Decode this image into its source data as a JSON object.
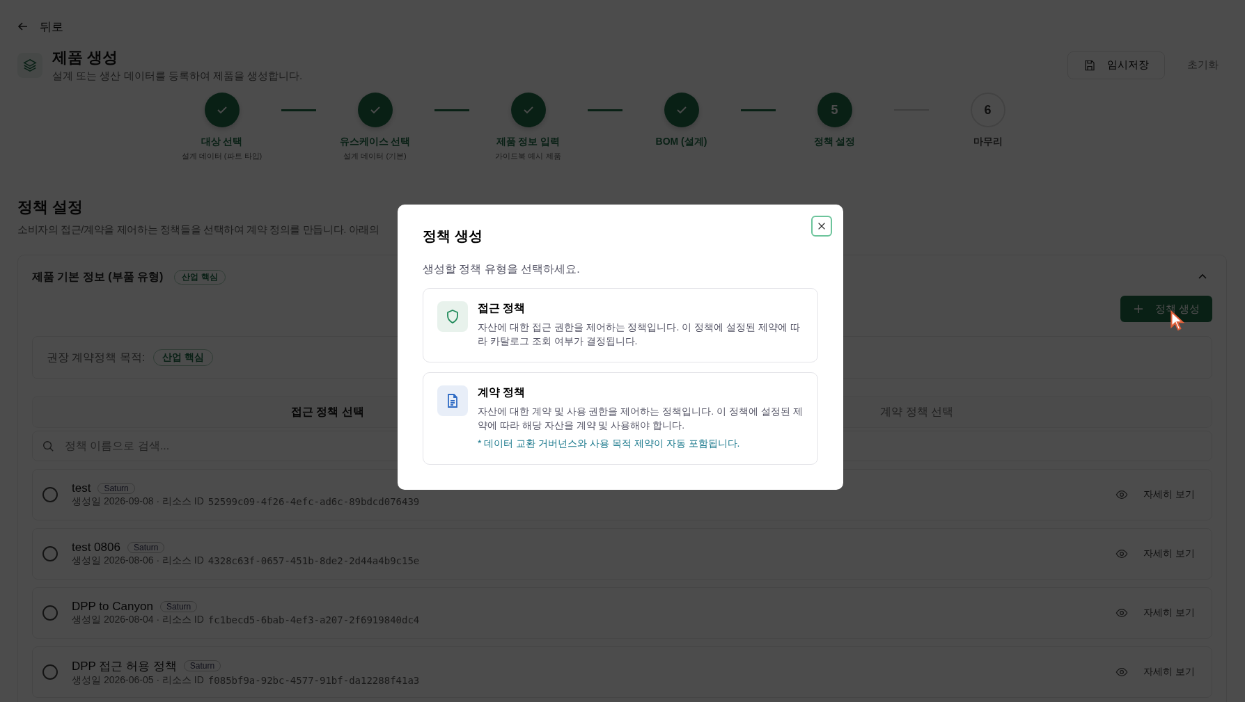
{
  "back": {
    "label": "뒤로"
  },
  "header": {
    "title": "제품 생성",
    "subtitle": "설계 또는 생산 데이터를 등록하여 제품을 생성합니다.",
    "save_button": "임시저장",
    "reset_button": "초기화"
  },
  "steps": [
    {
      "label": "대상 선택",
      "sublabel": "설계 데이터 (파트 타입)",
      "completed": true,
      "current": false
    },
    {
      "label": "유스케이스 선택",
      "sublabel": "설계 데이터 (기본)",
      "completed": true,
      "current": false
    },
    {
      "label": "제품 정보 입력",
      "sublabel": "가이드북 예시 제품",
      "completed": true,
      "current": false
    },
    {
      "label": "BOM (설계)",
      "completed": true,
      "current": false
    },
    {
      "marker": "5",
      "label": "정책 설정",
      "completed": false,
      "current": true
    },
    {
      "marker": "6",
      "label": "마무리",
      "completed": false,
      "current": false
    }
  ],
  "section": {
    "title": "정책 설정",
    "description": "소비자의 접근/계약을 제어하는 정책들을 선택하여 계약 정의를 만듭니다. 아래의"
  },
  "card": {
    "title": "제품 기본 정보 (부품 유형)",
    "badge": "산업 핵심",
    "expanded": true,
    "create_button": "정책 생성",
    "recommendation": {
      "label": "권장 계약정책 목적:",
      "badge": "산업 핵심"
    },
    "tabs": [
      {
        "label": "접근 정책 선택",
        "selected": true
      },
      {
        "label": "계약 정책 선택",
        "selected": false
      }
    ],
    "search": {
      "placeholder": "정책 이름으로 검색..."
    },
    "policies": [
      {
        "name": "test",
        "tag": "Saturn",
        "meta": "생성일 2026-09-08 · 리소스 ID",
        "id": "52599c09-4f26-4efc-ad6c-89bdcd076439",
        "selected": false,
        "action": "자세히 보기"
      },
      {
        "name": "test 0806",
        "tag": "Saturn",
        "meta": "생성일 2026-08-06 · 리소스 ID",
        "id": "4328c63f-0657-451b-8de2-2d44a4b9c15e",
        "selected": false,
        "action": "자세히 보기"
      },
      {
        "name": "DPP to Canyon",
        "tag": "Saturn",
        "meta": "생성일 2026-08-04 · 리소스 ID",
        "id": "fc1becd5-6bab-4ef3-a207-2f6919840dc4",
        "selected": false,
        "action": "자세히 보기"
      },
      {
        "name": "DPP 접근 허용 정책",
        "tag": "Saturn",
        "meta": "생성일 2026-06-05 · 리소스 ID",
        "id": "f085bf9a-92bc-4577-91bf-da12288f41a3",
        "selected": false,
        "action": "자세히 보기"
      }
    ]
  },
  "modal": {
    "title": "정책 생성",
    "prompt": "생성할 정책 유형을 선택하세요.",
    "options": [
      {
        "kind": "access",
        "title": "접근 정책",
        "description": "자산에 대한 접근 권한을 제어하는 정책입니다. 이 정책에 설정된 제약에 따라 카탈로그 조회 여부가 결정됩니다."
      },
      {
        "kind": "contract",
        "title": "계약 정책",
        "description": "자산에 대한 계약 및 사용 권한을 제어하는 정책입니다. 이 정책에 설정된 제약에 따라 해당 자산을 계약 및 사용해야 합니다.",
        "note": "* 데이터 교환 거버넌스와 사용 목적 제약이 자동 포함됩니다."
      }
    ]
  }
}
